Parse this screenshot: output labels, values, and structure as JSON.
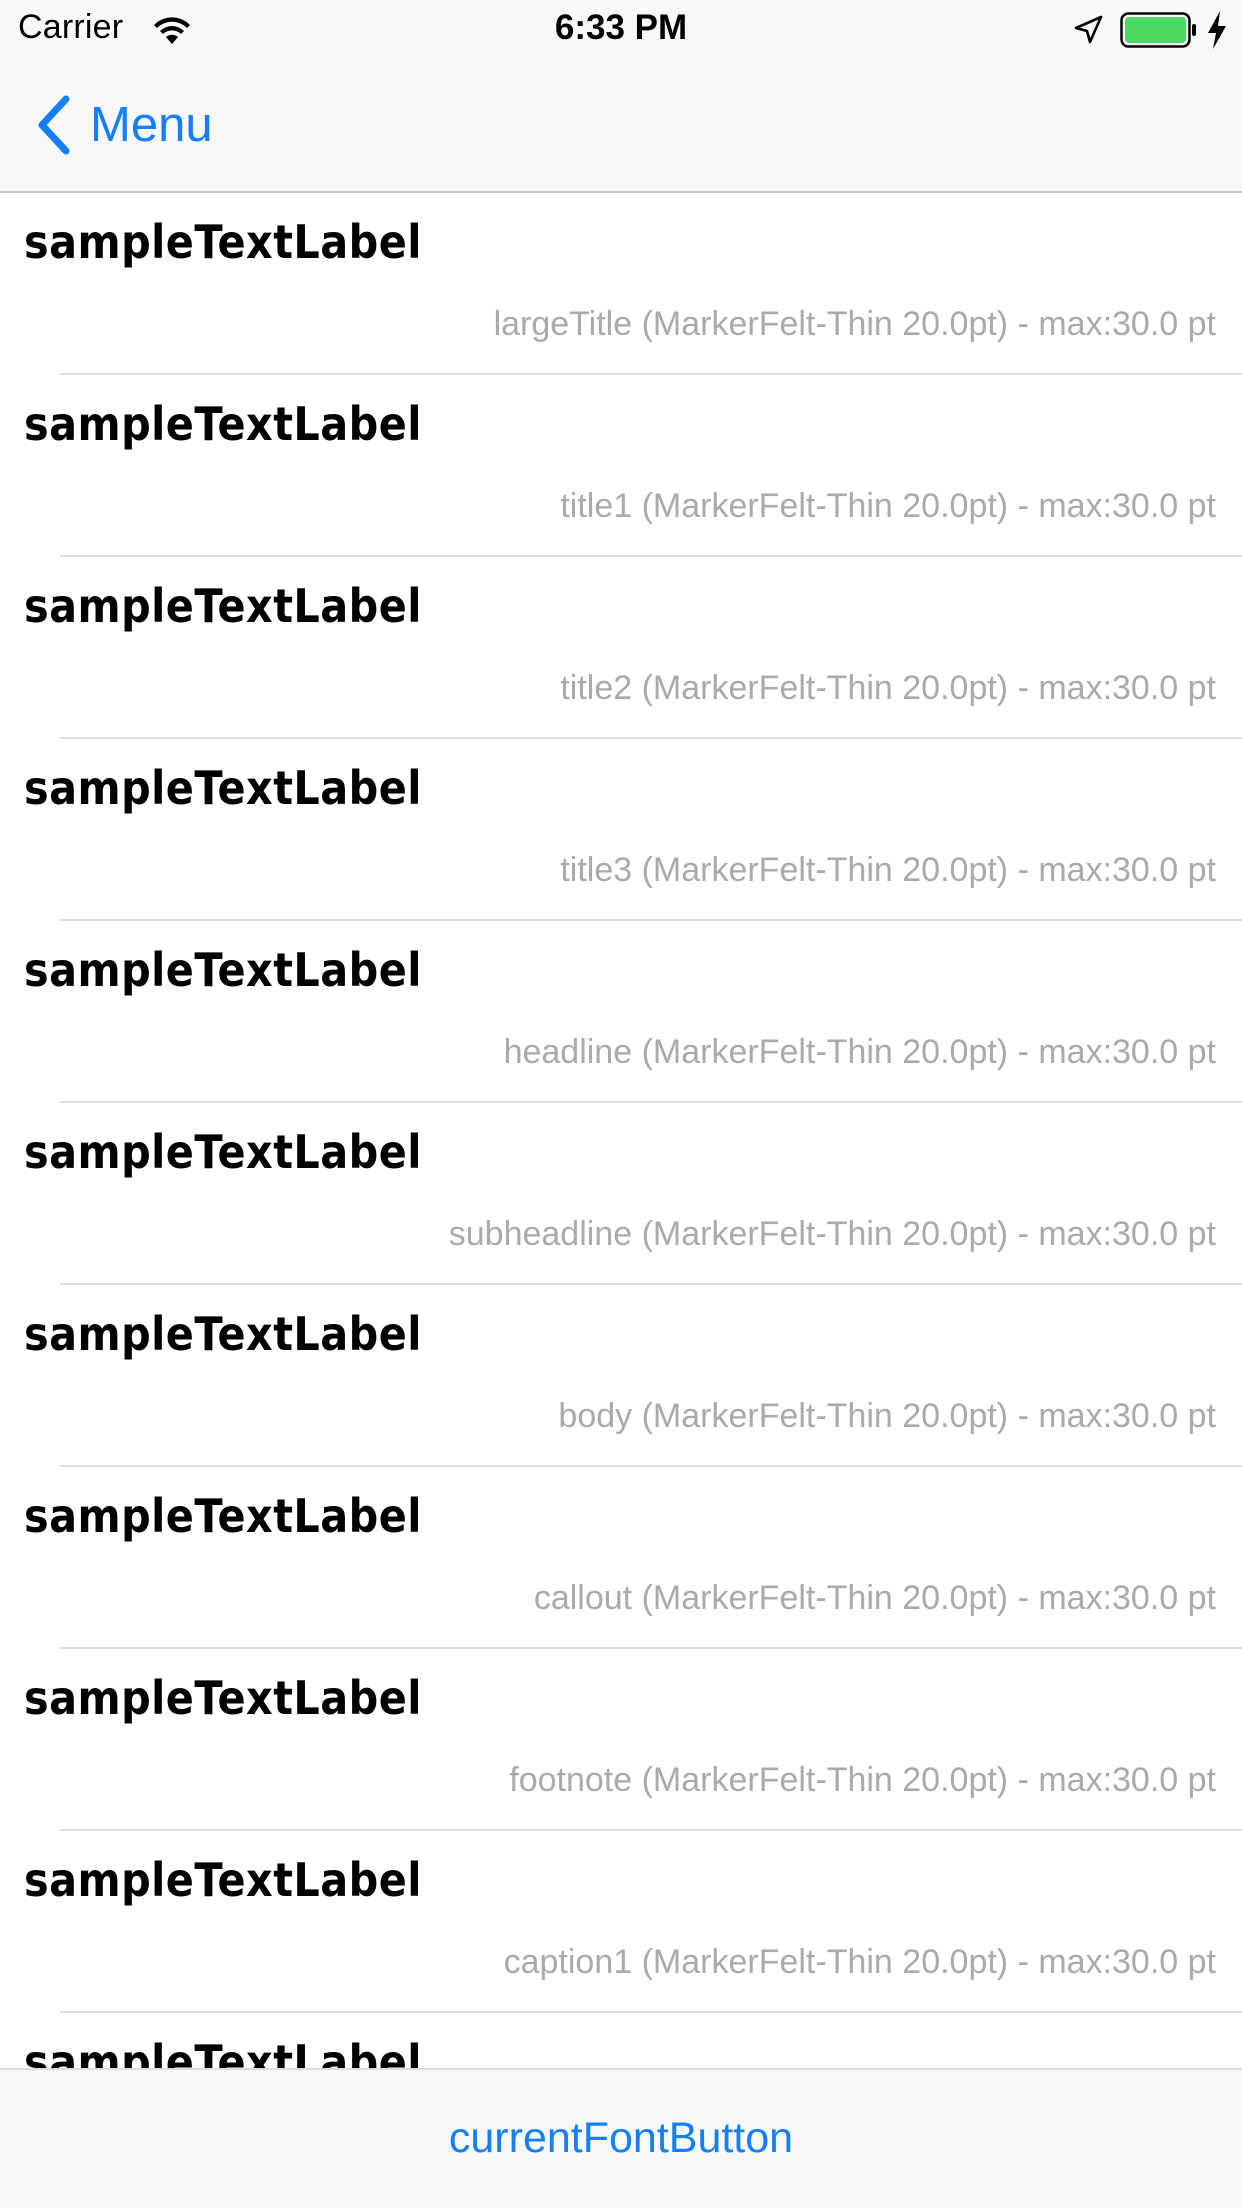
{
  "status_bar": {
    "carrier": "Carrier",
    "time": "6:33 PM",
    "battery_level": 1.0,
    "icons": [
      "wifi-icon",
      "location-icon",
      "battery-icon",
      "charging-icon"
    ]
  },
  "nav": {
    "back_label": "Menu",
    "back_icon": "chevron-left-icon"
  },
  "rows": [
    {
      "sample": "sampleTextLabel",
      "detail": "largeTitle (MarkerFelt-Thin 20.0pt) - max:30.0 pt"
    },
    {
      "sample": "sampleTextLabel",
      "detail": "title1 (MarkerFelt-Thin 20.0pt) - max:30.0 pt"
    },
    {
      "sample": "sampleTextLabel",
      "detail": "title2 (MarkerFelt-Thin 20.0pt) - max:30.0 pt"
    },
    {
      "sample": "sampleTextLabel",
      "detail": "title3 (MarkerFelt-Thin 20.0pt) - max:30.0 pt"
    },
    {
      "sample": "sampleTextLabel",
      "detail": "headline (MarkerFelt-Thin 20.0pt) - max:30.0 pt"
    },
    {
      "sample": "sampleTextLabel",
      "detail": "subheadline (MarkerFelt-Thin 20.0pt) - max:30.0 pt"
    },
    {
      "sample": "sampleTextLabel",
      "detail": "body (MarkerFelt-Thin 20.0pt) - max:30.0 pt"
    },
    {
      "sample": "sampleTextLabel",
      "detail": "callout (MarkerFelt-Thin 20.0pt) - max:30.0 pt"
    },
    {
      "sample": "sampleTextLabel",
      "detail": "footnote (MarkerFelt-Thin 20.0pt) - max:30.0 pt"
    },
    {
      "sample": "sampleTextLabel",
      "detail": "caption1 (MarkerFelt-Thin 20.0pt) - max:30.0 pt"
    },
    {
      "sample": "sampleTextLabel",
      "detail": ""
    }
  ],
  "toolbar": {
    "font_button_label": "currentFontButton"
  },
  "colors": {
    "accent": "#157efb",
    "detail_text": "#a9a9ae",
    "bar_background": "#f8f8f8",
    "battery_fill": "#4cd964"
  }
}
